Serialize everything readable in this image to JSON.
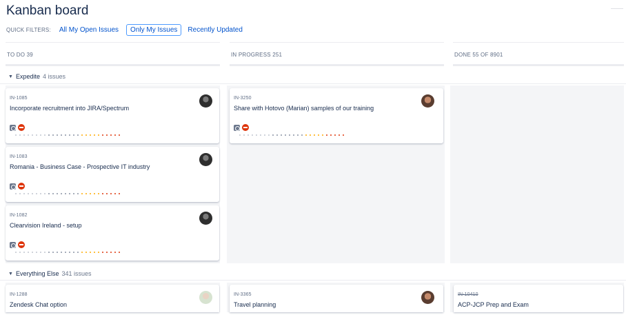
{
  "board": {
    "title": "Kanban board",
    "quick_filters": {
      "label": "QUICK FILTERS:",
      "items": [
        {
          "label": "All My Open Issues",
          "active": false
        },
        {
          "label": "Only My Issues",
          "active": true
        },
        {
          "label": "Recently Updated",
          "active": false
        }
      ]
    }
  },
  "columns": [
    {
      "label": "TO DO 39"
    },
    {
      "label": "IN PROGRESS 251"
    },
    {
      "label": "DONE 55 OF 8901"
    }
  ],
  "swimlanes": [
    {
      "label": "Expedite",
      "count": "4 issues"
    },
    {
      "label": "Everything Else",
      "count": "341 issues"
    }
  ],
  "cards": {
    "expedite_todo": [
      {
        "key": "IN-1085",
        "summary": "Incorporate recruitment into JIRA/Spectrum",
        "avatar": "avatar-dark-icon"
      },
      {
        "key": "IN-1083",
        "summary": "Romania - Business Case - Prospective IT industry",
        "avatar": "avatar-dark-icon"
      },
      {
        "key": "IN-1082",
        "summary": "Clearvision Ireland - setup",
        "avatar": "avatar-dark-icon"
      }
    ],
    "expedite_inprogress": [
      {
        "key": "IN-3250",
        "summary": "Share with Hotovo (Marian) samples of our training",
        "avatar": "avatar-face-icon"
      }
    ],
    "else_todo": [
      {
        "key": "IN-1288",
        "summary": "Zendesk Chat option",
        "avatar": "avatar-light-icon"
      }
    ],
    "else_inprogress": [
      {
        "key": "IN-3365",
        "summary": "Travel planning",
        "avatar": "avatar-face-icon"
      }
    ],
    "else_done": [
      {
        "key": "IN-10410",
        "summary": "ACP-JCP Prep and Exam"
      }
    ]
  },
  "icons": {
    "issue_type": "task-type-icon",
    "priority": "blocker-priority-icon",
    "swimlane_toggle": "chevron-down-icon"
  },
  "colors": {
    "link": "#0052cc",
    "column_bg": "#f4f5f7",
    "priority_red": "#de350b",
    "age_dots": [
      "#c1c7d0",
      "#8993a4",
      "#ffab00",
      "#de350b"
    ]
  }
}
